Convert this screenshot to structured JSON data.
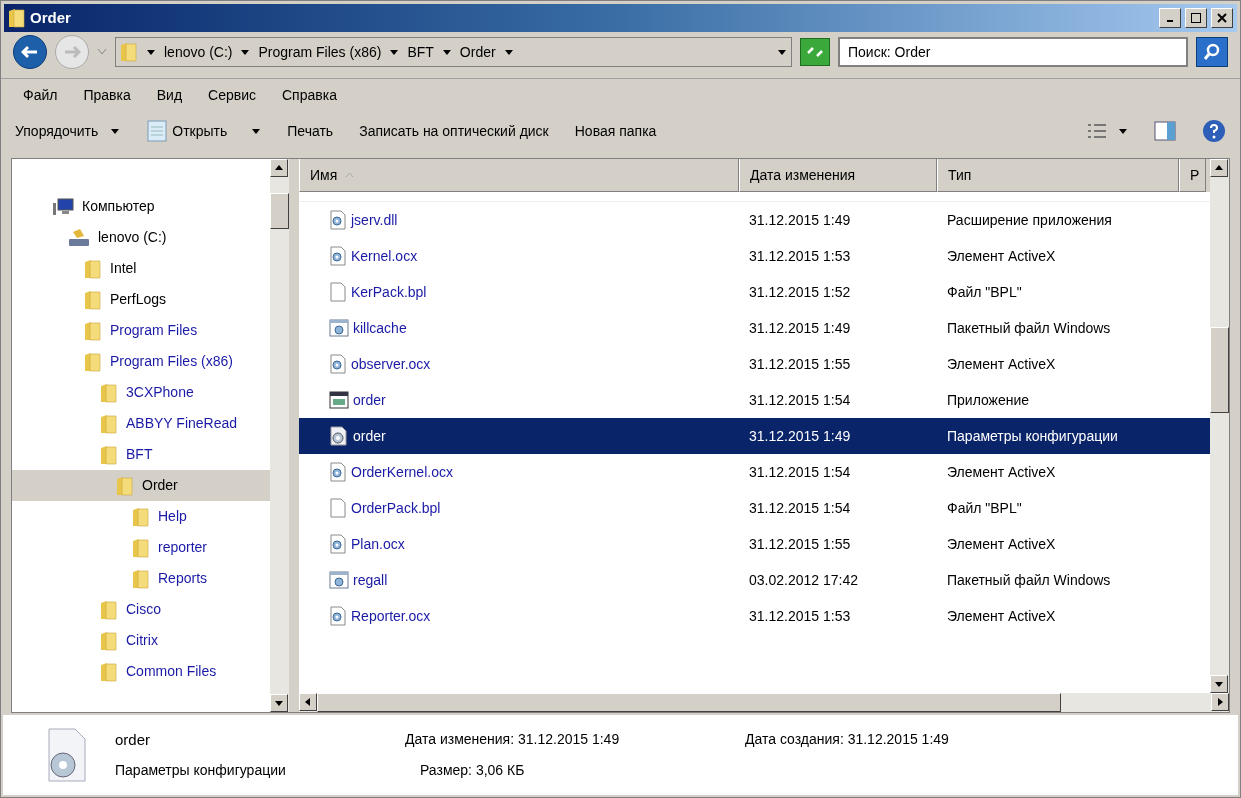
{
  "window": {
    "title": "Order"
  },
  "address": {
    "crumbs": [
      "lenovo (C:)",
      "Program Files (x86)",
      "BFT",
      "Order"
    ]
  },
  "search": {
    "placeholder": "Поиск: Order"
  },
  "menu": [
    "Файл",
    "Правка",
    "Вид",
    "Сервис",
    "Справка"
  ],
  "toolbar": [
    {
      "label": "Упорядочить",
      "kind": "dropdown"
    },
    {
      "label": "Открыть",
      "kind": "open"
    },
    {
      "label": "Печать",
      "kind": "plain"
    },
    {
      "label": "Записать на оптический диск",
      "kind": "plain"
    },
    {
      "label": "Новая папка",
      "kind": "plain"
    }
  ],
  "tree": [
    {
      "label": "Компьютер",
      "kind": "computer",
      "selected": false,
      "color": "#000000",
      "children": [
        {
          "label": "lenovo (C:)",
          "kind": "drive",
          "selected": false,
          "color": "#000000",
          "children": [
            {
              "label": "Intel",
              "kind": "folder",
              "selected": false,
              "color": "#000000"
            },
            {
              "label": "PerfLogs",
              "kind": "folder",
              "selected": false,
              "color": "#000000"
            },
            {
              "label": "Program Files",
              "kind": "folder",
              "selected": false,
              "color": "#1a1aa6"
            },
            {
              "label": "Program Files (x86)",
              "kind": "folder",
              "selected": false,
              "color": "#1a1aa6",
              "children": [
                {
                  "label": "3CXPhone",
                  "kind": "folder",
                  "selected": false,
                  "color": "#1a1aa6"
                },
                {
                  "label": "ABBYY FineRead",
                  "kind": "folder",
                  "selected": false,
                  "color": "#1a1aa6"
                },
                {
                  "label": "BFT",
                  "kind": "folder",
                  "selected": false,
                  "color": "#1a1aa6",
                  "children": [
                    {
                      "label": "Order",
                      "kind": "folder",
                      "selected": true,
                      "color": "#000000",
                      "children": [
                        {
                          "label": "Help",
                          "kind": "folder",
                          "selected": false,
                          "color": "#1a1aa6"
                        },
                        {
                          "label": "reporter",
                          "kind": "folder",
                          "selected": false,
                          "color": "#1a1aa6"
                        },
                        {
                          "label": "Reports",
                          "kind": "folder",
                          "selected": false,
                          "color": "#1a1aa6"
                        }
                      ]
                    }
                  ]
                },
                {
                  "label": "Cisco",
                  "kind": "folder",
                  "selected": false,
                  "color": "#1a1aa6"
                },
                {
                  "label": "Citrix",
                  "kind": "folder",
                  "selected": false,
                  "color": "#1a1aa6"
                },
                {
                  "label": "Common Files",
                  "kind": "folder",
                  "selected": false,
                  "color": "#1a1aa6"
                }
              ]
            }
          ]
        }
      ]
    }
  ],
  "table": {
    "columns": [
      "Имя",
      "Дата изменения",
      "Тип",
      "Р"
    ],
    "rows": [
      {
        "name": "jserv.dll",
        "kind": "library",
        "date": "31.12.2015 1:49",
        "type": "Расширение приложения",
        "selected": false
      },
      {
        "name": "Kernel.ocx",
        "kind": "library",
        "date": "31.12.2015 1:53",
        "type": "Элемент ActiveX",
        "selected": false
      },
      {
        "name": "KerPack.bpl",
        "kind": "blank",
        "date": "31.12.2015 1:52",
        "type": "Файл \"BPL\"",
        "selected": false
      },
      {
        "name": "killcache",
        "kind": "batch",
        "date": "31.12.2015 1:49",
        "type": "Пакетный файл Windows",
        "selected": false
      },
      {
        "name": "observer.ocx",
        "kind": "library",
        "date": "31.12.2015 1:55",
        "type": "Элемент ActiveX",
        "selected": false
      },
      {
        "name": "order",
        "kind": "app",
        "date": "31.12.2015 1:54",
        "type": "Приложение",
        "selected": false
      },
      {
        "name": "order",
        "kind": "config",
        "date": "31.12.2015 1:49",
        "type": "Параметры конфигурации",
        "selected": true
      },
      {
        "name": "OrderKernel.ocx",
        "kind": "library",
        "date": "31.12.2015 1:54",
        "type": "Элемент ActiveX",
        "selected": false
      },
      {
        "name": "OrderPack.bpl",
        "kind": "blank",
        "date": "31.12.2015 1:54",
        "type": "Файл \"BPL\"",
        "selected": false
      },
      {
        "name": "Plan.ocx",
        "kind": "library",
        "date": "31.12.2015 1:55",
        "type": "Элемент ActiveX",
        "selected": false
      },
      {
        "name": "regall",
        "kind": "batch",
        "date": "03.02.2012 17:42",
        "type": "Пакетный файл Windows",
        "selected": false
      },
      {
        "name": "Reporter.ocx",
        "kind": "library",
        "date": "31.12.2015 1:53",
        "type": "Элемент ActiveX",
        "selected": false
      }
    ]
  },
  "details": {
    "name": "order",
    "type": "Параметры конфигурации",
    "modified": "Дата изменения: 31.12.2015 1:49",
    "size": "Размер: 3,06 КБ",
    "created": "Дата создания: 31.12.2015 1:49"
  }
}
